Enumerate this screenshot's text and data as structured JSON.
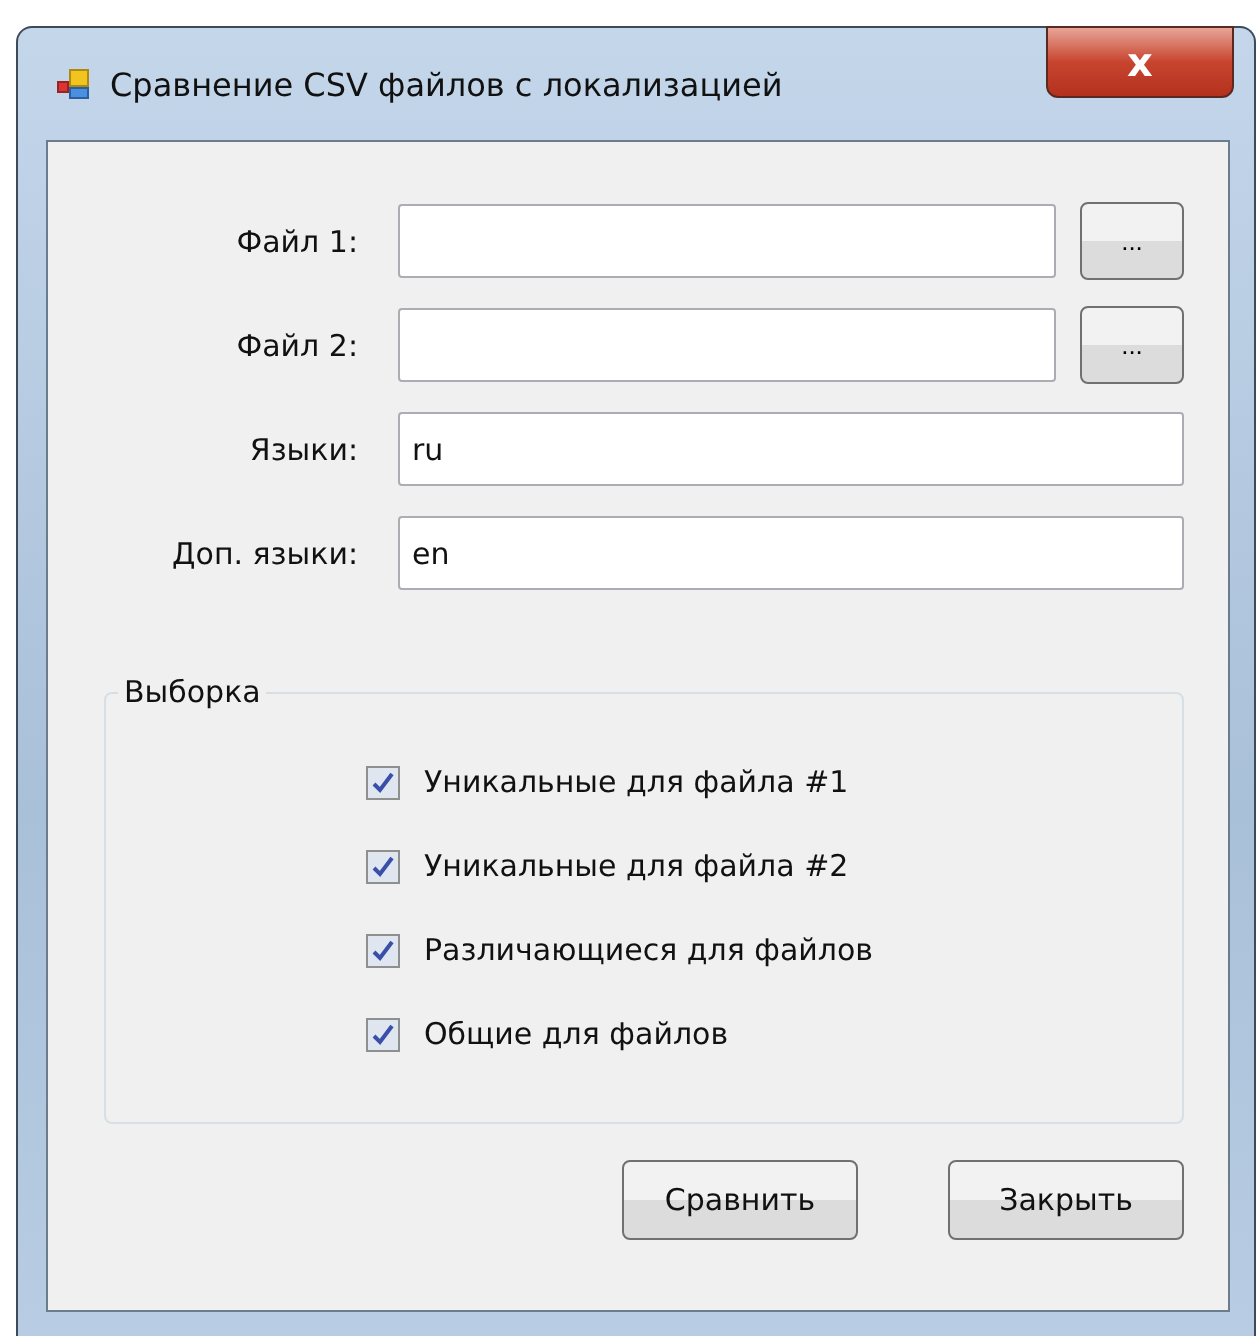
{
  "window": {
    "title": "Сравнение CSV файлов с локализацией",
    "close": "x"
  },
  "fields": [
    {
      "kind": "file",
      "label": "Файл 1:",
      "browse": "..."
    },
    {
      "kind": "file",
      "label": "Файл 2:",
      "browse": "..."
    },
    {
      "kind": "text",
      "label": "Языки:",
      "value": "ru"
    },
    {
      "kind": "text",
      "label": "Доп. языки:",
      "value": "en"
    }
  ],
  "group": {
    "title": "Выборка",
    "options": [
      {
        "label": "Уникальные для файла #1",
        "checked": true
      },
      {
        "label": "Уникальные для файла #2",
        "checked": true
      },
      {
        "label": "Различающиеся для файлов",
        "checked": true
      },
      {
        "label": "Общие для файлов",
        "checked": true
      }
    ]
  },
  "buttons": [
    "Сравнить",
    "Закрыть"
  ]
}
